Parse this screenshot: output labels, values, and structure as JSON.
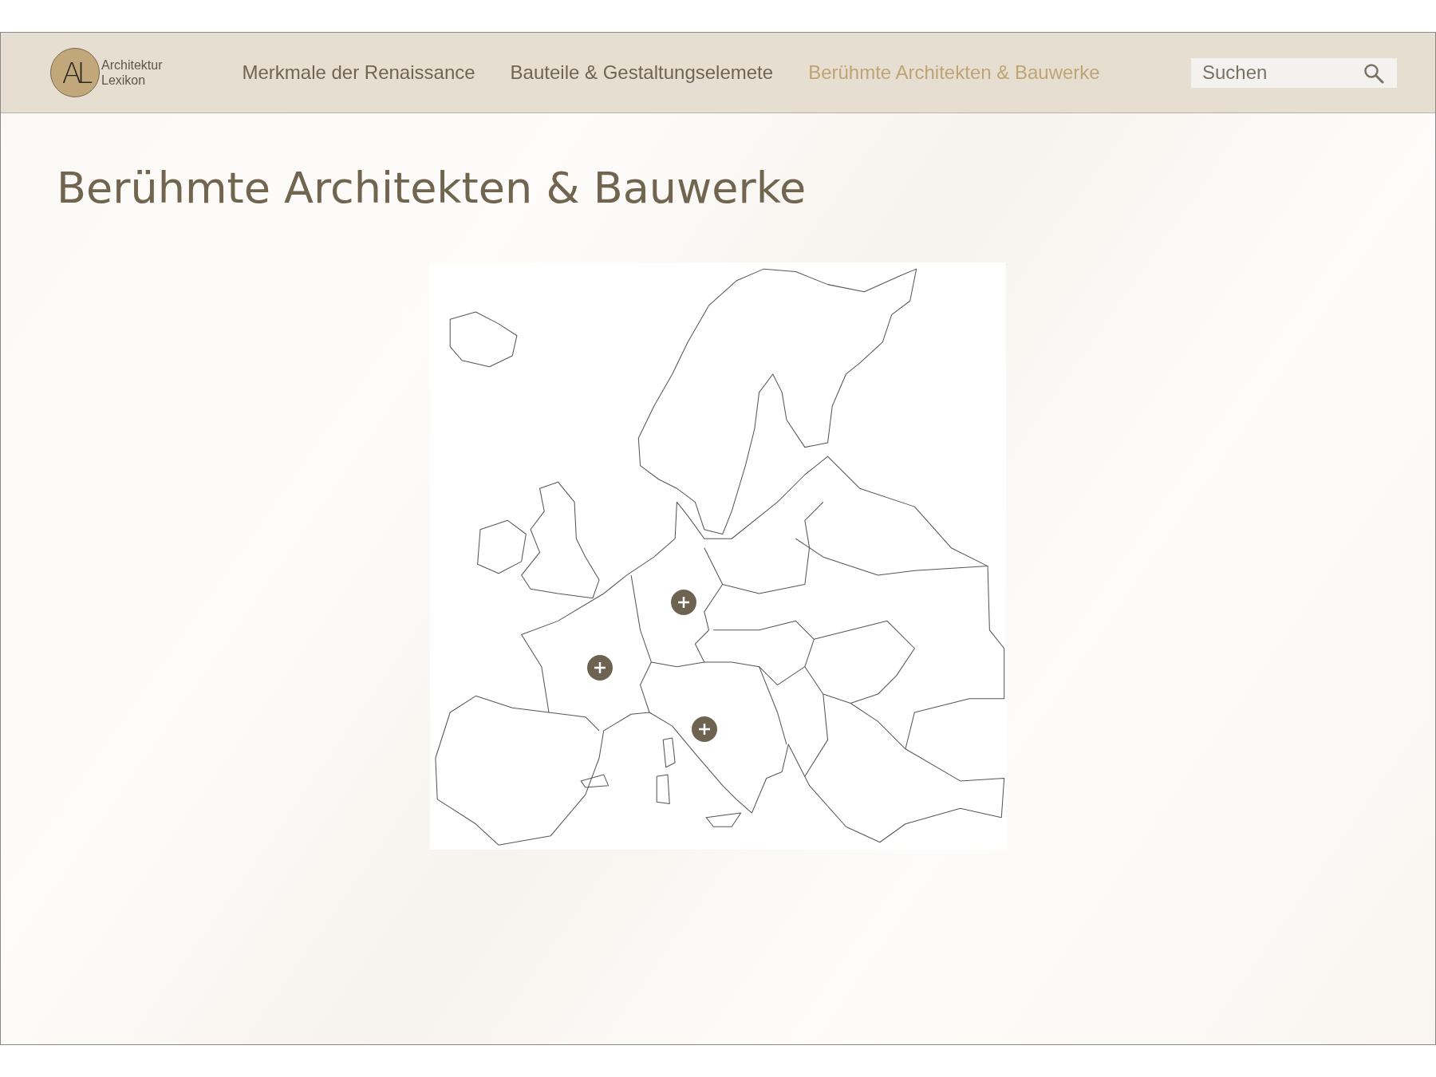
{
  "logo": {
    "mark": "AL",
    "lines": [
      "Architektur",
      "Lexikon"
    ]
  },
  "nav": [
    {
      "label": "Merkmale der Renaissance",
      "selected": false
    },
    {
      "label": "Bauteile & Gestaltungselemete",
      "selected": false
    },
    {
      "label": "Berühmte Architekten & Bauwerke",
      "selected": true
    }
  ],
  "search": {
    "placeholder": "Suchen"
  },
  "title": "Berühmte Architekten & Bauwerke"
}
